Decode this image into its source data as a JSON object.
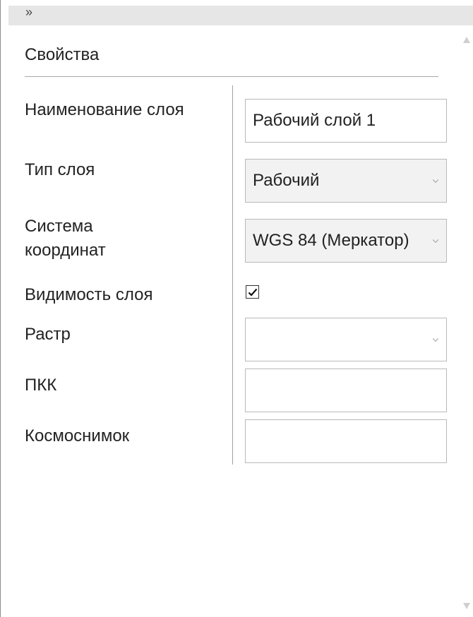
{
  "panel": {
    "collapse_glyph": "»",
    "section_title": "Свойства"
  },
  "fields": {
    "layer_name": {
      "label": "Наименование слоя",
      "value": "Рабочий слой 1"
    },
    "layer_type": {
      "label": "Тип слоя",
      "value": "Рабочий"
    },
    "coord_system": {
      "label": "Система координат",
      "value": "WGS 84 (Меркатор)"
    },
    "layer_visibility": {
      "label": "Видимость слоя",
      "checked": true
    },
    "raster": {
      "label": "Растр",
      "value": ""
    },
    "pkk": {
      "label": "ПКК",
      "value": ""
    },
    "satellite_image": {
      "label": "Космоснимок",
      "value": ""
    }
  },
  "icons": {
    "collapse": "double-chevron-right-icon",
    "dropdown": "chevron-down-icon",
    "check": "checkmark-icon"
  }
}
